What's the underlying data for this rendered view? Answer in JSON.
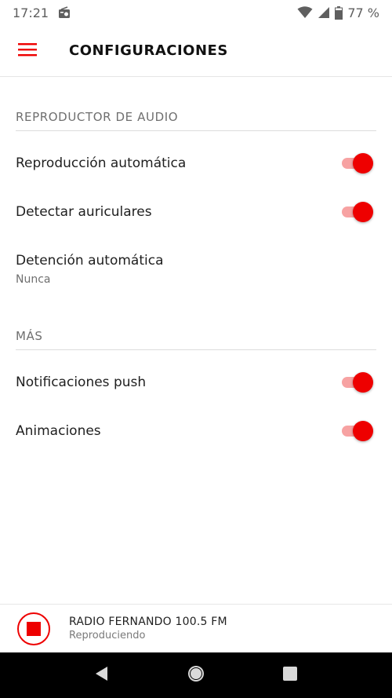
{
  "status_bar": {
    "time": "17:21",
    "battery": "77 %"
  },
  "header": {
    "title": "CONFIGURACIONES"
  },
  "sections": {
    "audio": {
      "title": "REPRODUCTOR DE AUDIO",
      "autoplay_label": "Reproducción automática",
      "headphones_label": "Detectar auriculares",
      "autostop_label": "Detención automática",
      "autostop_value": "Nunca"
    },
    "more": {
      "title": "MÁS",
      "push_label": "Notificaciones push",
      "animations_label": "Animaciones"
    }
  },
  "toggles": {
    "autoplay": true,
    "headphones": true,
    "push": true,
    "animations": true
  },
  "player": {
    "station": "RADIO FERNANDO 100.5 FM",
    "state": "Reproduciendo"
  },
  "colors": {
    "accent": "#ee0000",
    "track": "#f7a2a2"
  }
}
